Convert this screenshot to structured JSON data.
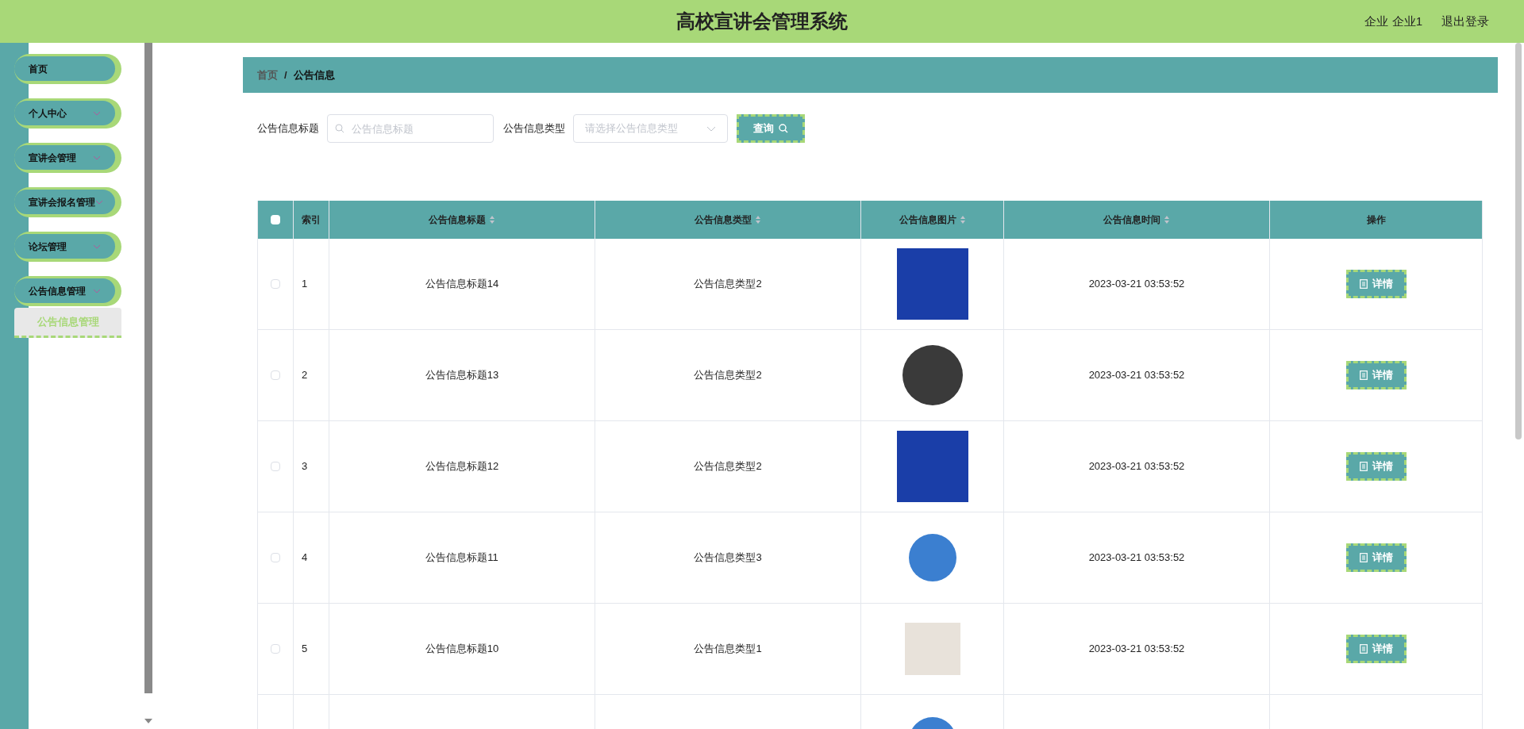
{
  "header": {
    "title": "高校宣讲会管理系统",
    "user": "企业 企业1",
    "logout": "退出登录"
  },
  "sidebar": {
    "items": [
      {
        "label": "首页",
        "kind": "link"
      },
      {
        "label": "个人中心",
        "kind": "menu"
      },
      {
        "label": "宣讲会管理",
        "kind": "menu"
      },
      {
        "label": "宣讲会报名管理",
        "kind": "menu"
      },
      {
        "label": "论坛管理",
        "kind": "menu"
      },
      {
        "label": "公告信息管理",
        "kind": "menu",
        "expanded": true,
        "children": [
          {
            "label": "公告信息管理",
            "selected": true
          }
        ]
      }
    ]
  },
  "breadcrumb": {
    "separator": "/",
    "items": [
      "首页",
      "公告信息"
    ]
  },
  "search": {
    "title_label": "公告信息标题",
    "title_placeholder": "公告信息标题",
    "type_label": "公告信息类型",
    "type_placeholder": "请选择公告信息类型",
    "button": "查询"
  },
  "table": {
    "select_all_checked": false,
    "columns": [
      {
        "label": "索引",
        "sortable": false
      },
      {
        "label": "公告信息标题",
        "sortable": true
      },
      {
        "label": "公告信息类型",
        "sortable": true
      },
      {
        "label": "公告信息图片",
        "sortable": true
      },
      {
        "label": "公告信息时间",
        "sortable": true
      },
      {
        "label": "操作",
        "sortable": false
      }
    ],
    "rows": [
      {
        "checked": false,
        "index": "1",
        "title": "公告信息标题14",
        "type": "公告信息类型2",
        "time": "2023-03-21 03:53:52",
        "action": "详情"
      },
      {
        "checked": false,
        "index": "2",
        "title": "公告信息标题13",
        "type": "公告信息类型2",
        "time": "2023-03-21 03:53:52",
        "action": "详情"
      },
      {
        "checked": false,
        "index": "3",
        "title": "公告信息标题12",
        "type": "公告信息类型2",
        "time": "2023-03-21 03:53:52",
        "action": "详情"
      },
      {
        "checked": false,
        "index": "4",
        "title": "公告信息标题11",
        "type": "公告信息类型3",
        "time": "2023-03-21 03:53:52",
        "action": "详情"
      },
      {
        "checked": false,
        "index": "5",
        "title": "公告信息标题10",
        "type": "公告信息类型1",
        "time": "2023-03-21 03:53:52",
        "action": "详情"
      }
    ]
  }
}
